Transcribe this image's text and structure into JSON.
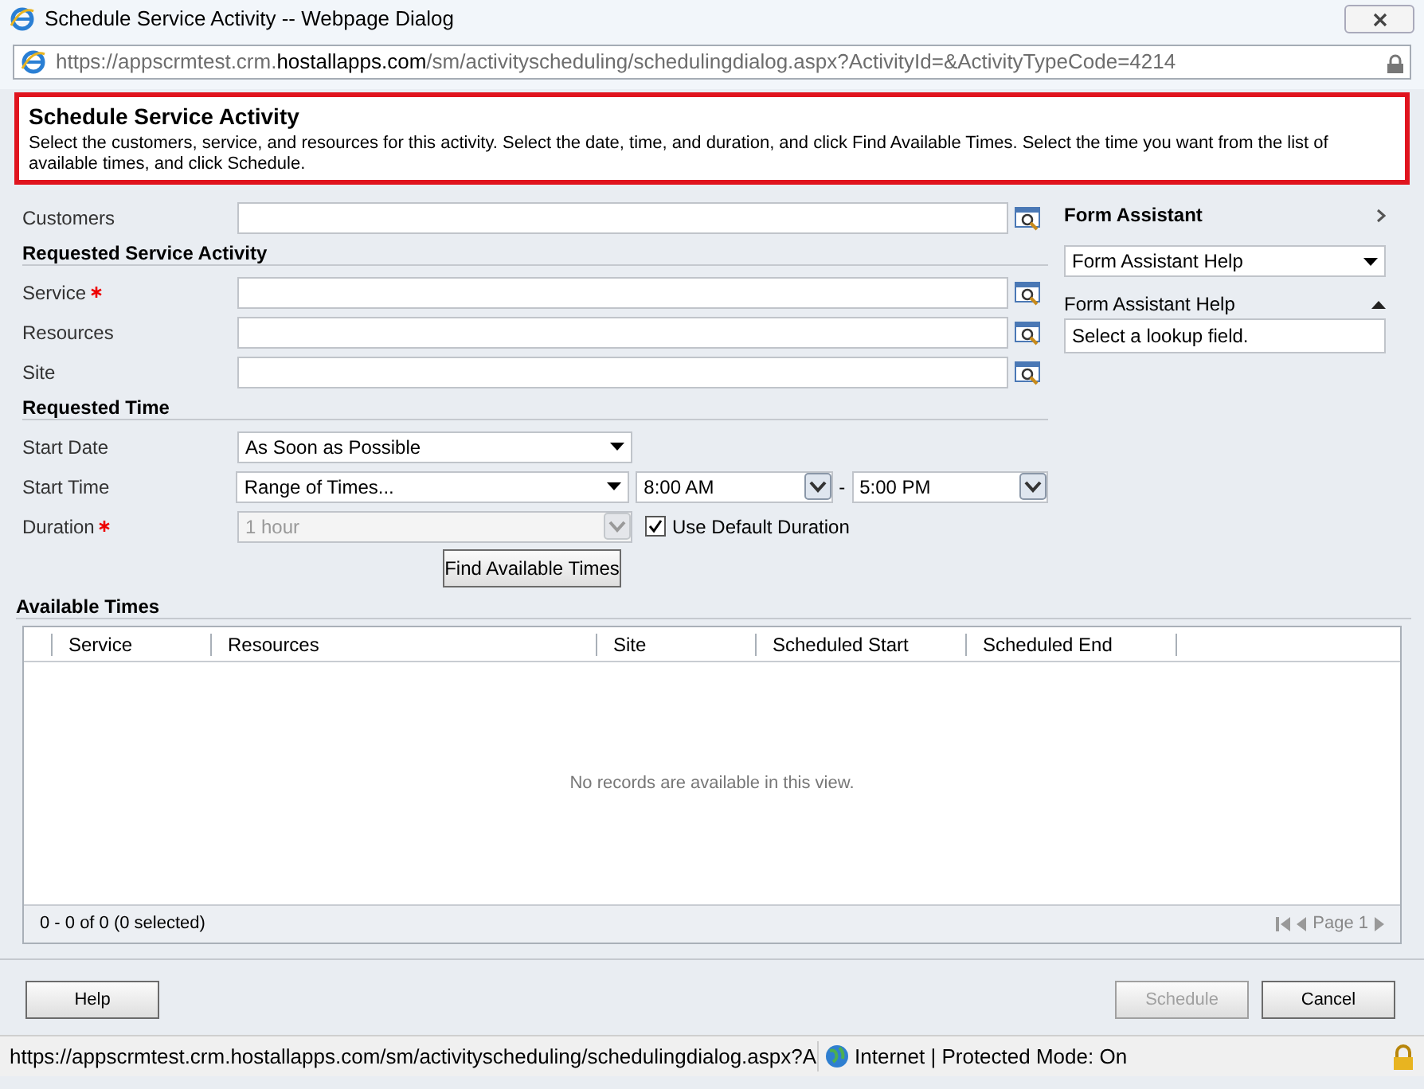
{
  "window": {
    "title": "Schedule Service Activity -- Webpage Dialog"
  },
  "address": {
    "prefix": "https://appscrmtest.crm.",
    "domain": "hostallapps.com",
    "path": "/sm/activityscheduling/schedulingdialog.aspx?ActivityId=&ActivityTypeCode=4214"
  },
  "header": {
    "title": "Schedule Service Activity",
    "description": "Select the customers, service, and resources for this activity. Select the date, time, and duration, and click Find Available Times. Select the time you want from the list of available times, and click Schedule."
  },
  "form": [
    {
      "kind": "lookup",
      "label": "Customers",
      "required": false
    },
    {
      "kind": "section",
      "label": "Requested Service Activity"
    },
    {
      "kind": "lookup",
      "label": "Service",
      "required": true
    },
    {
      "kind": "lookup",
      "label": "Resources",
      "required": false
    },
    {
      "kind": "lookup",
      "label": "Site",
      "required": false
    },
    {
      "kind": "section",
      "label": "Requested Time"
    },
    {
      "kind": "select",
      "label": "Start Date",
      "value": "As Soon as Possible"
    },
    {
      "kind": "time_range",
      "label": "Start Time",
      "value": "Range of Times...",
      "from": "8:00 AM",
      "separator": "-",
      "to": "5:00 PM"
    },
    {
      "kind": "duration",
      "label": "Duration",
      "required": true,
      "value": "1 hour",
      "disabled": true,
      "checkbox": {
        "label": "Use Default Duration",
        "checked": true
      }
    }
  ],
  "find_button": "Find Available Times",
  "assistant": {
    "title": "Form Assistant",
    "dropdown": "Form Assistant Help",
    "panel_title": "Form Assistant Help",
    "panel_text": "Select a lookup field."
  },
  "available_times": {
    "title": "Available Times",
    "columns": [
      "Service",
      "Resources",
      "Site",
      "Scheduled Start",
      "Scheduled End"
    ],
    "empty_message": "No records are available in this view.",
    "record_count": "0 - 0 of 0 (0 selected)",
    "page": "Page 1"
  },
  "buttons": [
    {
      "label": "Help",
      "disabled": false
    },
    {
      "label": "Schedule",
      "disabled": true
    },
    {
      "label": "Cancel",
      "disabled": false
    }
  ],
  "status_bar": {
    "url": "https://appscrmtest.crm.hostallapps.com/sm/activityscheduling/schedulingdialog.aspx?A",
    "zone": "Internet | Protected Mode: On"
  }
}
